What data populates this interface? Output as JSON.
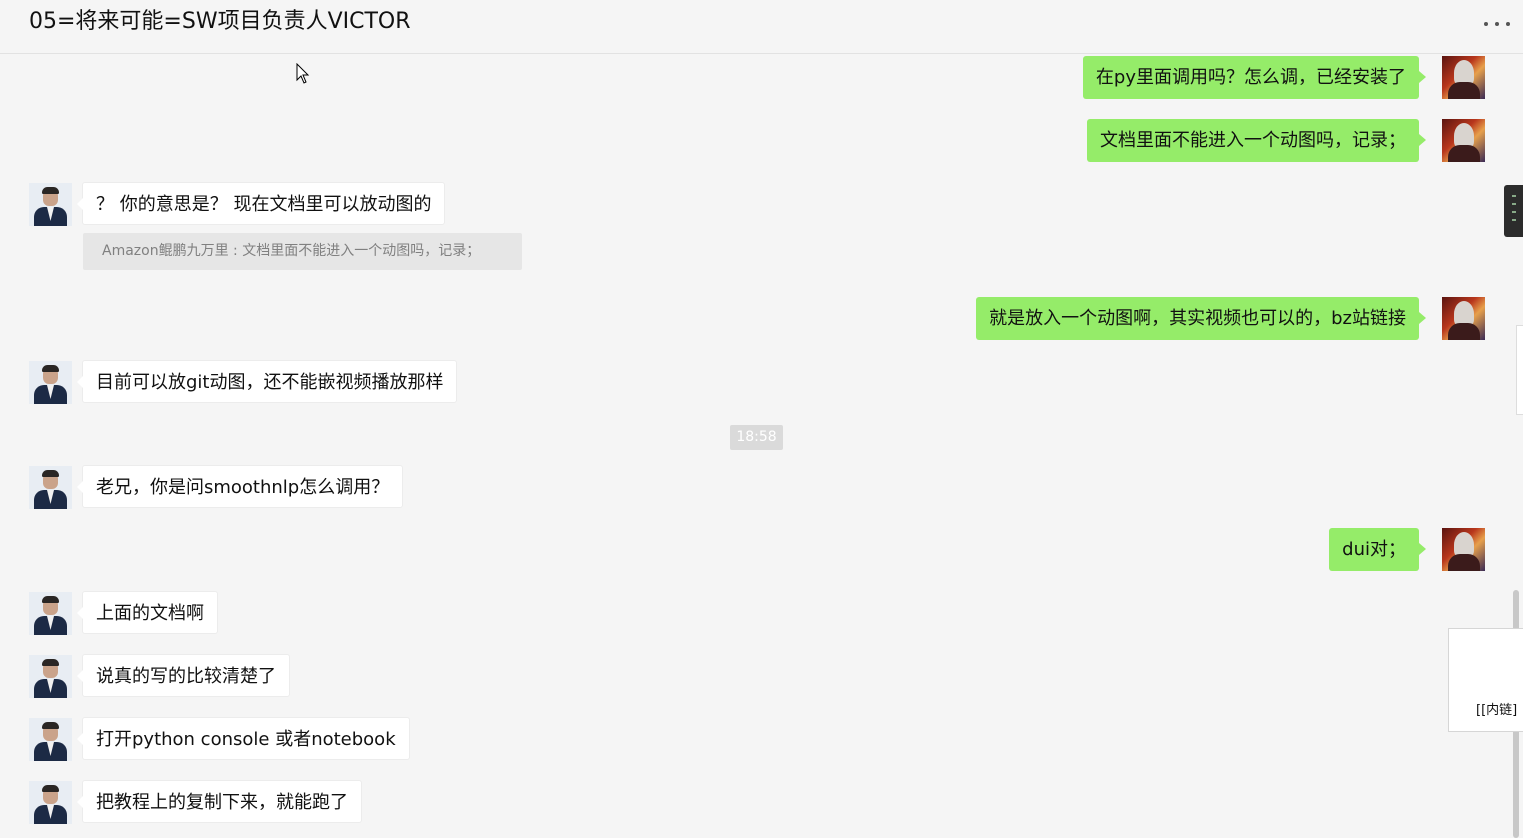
{
  "header": {
    "title": "05=将来可能=SW项目负责人VICTOR",
    "more_icon": "more-dots-icon"
  },
  "messages": [
    {
      "from": "self",
      "text": "在py里面调用吗？怎么调，已经安装了"
    },
    {
      "from": "self",
      "text": "文档里面不能进入一个动图吗，记录；"
    },
    {
      "from": "peer",
      "text": "？ 你的意思是？ 现在文档里可以放动图的"
    },
    {
      "from": "self",
      "text": "就是放入一个动图啊，其实视频也可以的，bz站链接"
    },
    {
      "from": "peer",
      "text": "目前可以放git动图，还不能嵌视频播放那样"
    },
    {
      "from": "peer",
      "text": "老兄，你是问smoothnlp怎么调用？"
    },
    {
      "from": "self",
      "text": "dui对；"
    },
    {
      "from": "peer",
      "text": "上面的文档啊"
    },
    {
      "from": "peer",
      "text": "说真的写的比较清楚了"
    },
    {
      "from": "peer",
      "text": "打开python console 或者notebook"
    },
    {
      "from": "peer",
      "text": "把教程上的复制下来，就能跑了"
    }
  ],
  "quote": {
    "text": "Amazon鲲鹏九万里 : 文档里面不能进入一个动图吗，记录；"
  },
  "timestamp": "18:58",
  "popup": {
    "text": "[[内链]"
  },
  "colors": {
    "self_bubble": "#95ec69",
    "peer_bubble": "#ffffff",
    "background": "#f5f5f5"
  }
}
